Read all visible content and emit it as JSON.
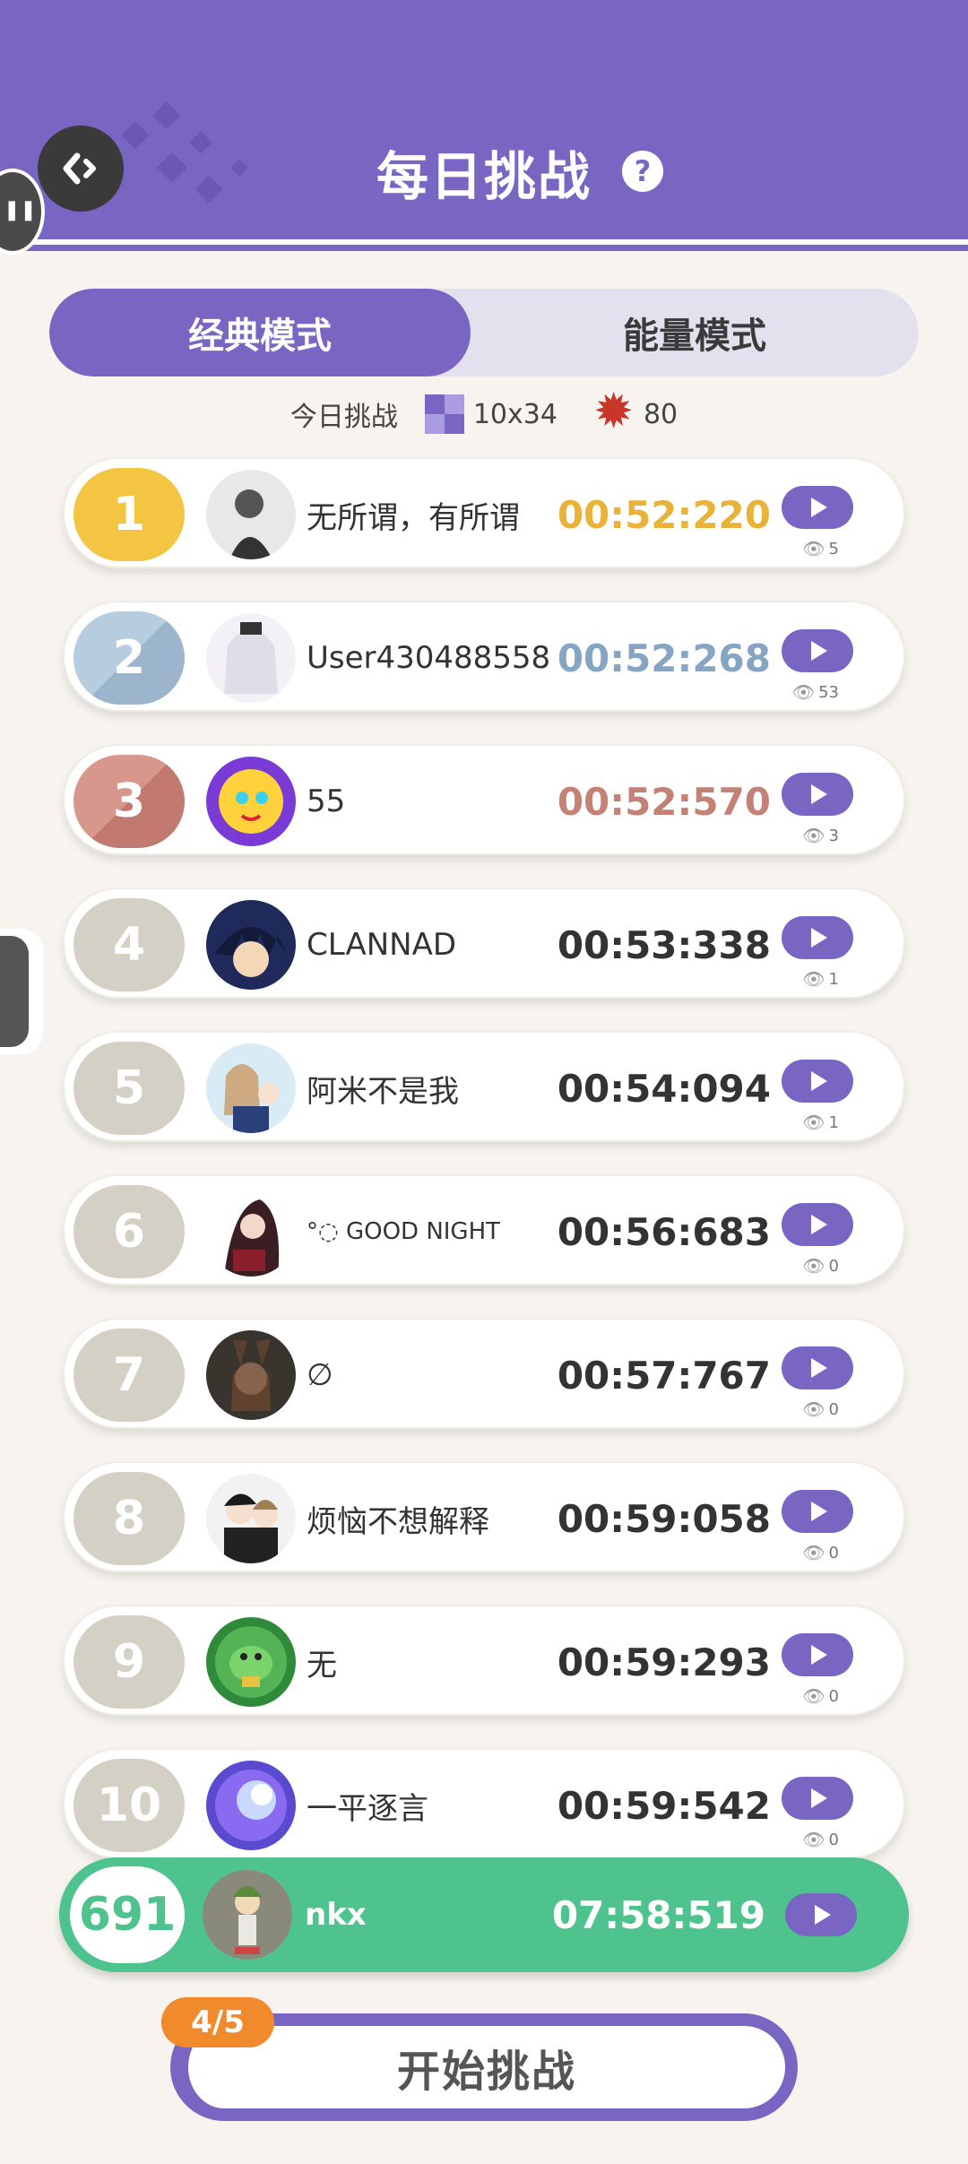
{
  "header": {
    "title": "每日挑战",
    "help_icon": "help-icon",
    "back_icon": "back-icon"
  },
  "tabs": [
    {
      "label": "经典模式",
      "active": true
    },
    {
      "label": "能量模式",
      "active": false
    }
  ],
  "today": {
    "label": "今日挑战",
    "grid_size": "10x34",
    "sun_count": "80"
  },
  "leaderboard": [
    {
      "rank": "1",
      "name": "无所谓，有所谓",
      "time": "00:52:220",
      "views": "5",
      "time_color": "#e9b33a"
    },
    {
      "rank": "2",
      "name": "User430488558",
      "time": "00:52:268",
      "views": "53",
      "time_color": "#86a5c2"
    },
    {
      "rank": "3",
      "name": "55",
      "time": "00:52:570",
      "views": "3",
      "time_color": "#c48276"
    },
    {
      "rank": "4",
      "name": "CLANNAD",
      "time": "00:53:338",
      "views": "1",
      "time_color": "#333333"
    },
    {
      "rank": "5",
      "name": "阿米不是我",
      "time": "00:54:094",
      "views": "1",
      "time_color": "#333333"
    },
    {
      "rank": "6",
      "name": "°◌ GOOD NIGHT",
      "time": "00:56:683",
      "views": "0",
      "time_color": "#333333"
    },
    {
      "rank": "7",
      "name": "∅",
      "time": "00:57:767",
      "views": "0",
      "time_color": "#333333"
    },
    {
      "rank": "8",
      "name": "烦恼不想解释",
      "time": "00:59:058",
      "views": "0",
      "time_color": "#333333"
    },
    {
      "rank": "9",
      "name": "无",
      "time": "00:59:293",
      "views": "0",
      "time_color": "#333333"
    },
    {
      "rank": "10",
      "name": "一平逐言",
      "time": "00:59:542",
      "views": "0",
      "time_color": "#333333"
    }
  ],
  "self": {
    "rank": "691",
    "name": "nkx",
    "time": "07:58:519"
  },
  "bottom": {
    "start_label": "开始挑战",
    "attempts": "4/5"
  },
  "colors": {
    "accent": "#7866c2",
    "self_green": "#4fc38e",
    "badge_orange": "#f08a2c"
  }
}
